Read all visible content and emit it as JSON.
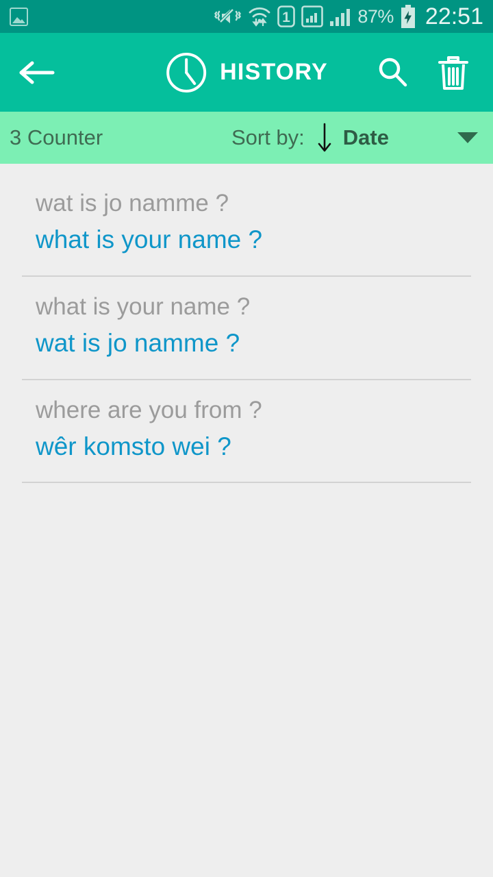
{
  "status_bar": {
    "notification_icon": "photo-icon",
    "vibrate_icon": "vibrate-mute-icon",
    "wifi_icon": "wifi-transfer-icon",
    "sim_label": "1",
    "signal_icon_1": "signal-bars-boxed-icon",
    "signal_icon_2": "signal-bars-icon",
    "battery_percent": "87%",
    "battery_icon": "battery-charging-icon",
    "time": "22:51"
  },
  "app_bar": {
    "back_icon": "arrow-left-icon",
    "clock_icon": "clock-icon",
    "title": "HISTORY",
    "search_icon": "search-icon",
    "delete_icon": "trash-icon"
  },
  "sort_bar": {
    "counter": "3 Counter",
    "sort_label": "Sort by:",
    "direction_icon": "arrow-down-icon",
    "sort_value": "Date",
    "dropdown_icon": "chevron-down-icon"
  },
  "history": [
    {
      "source": "wat is jo namme ?",
      "target": "what is your name ?"
    },
    {
      "source": "what is your name ?",
      "target": "wat is jo namme ?"
    },
    {
      "source": "where are you from ?",
      "target": "wêr komsto wei ?"
    }
  ],
  "colors": {
    "status_bar_bg": "#009482",
    "app_bar_bg": "#05bf9c",
    "sort_bar_bg": "#7cefb4",
    "page_bg": "#eeeeee",
    "source_text": "#9b9b9b",
    "target_text": "#0f96c9"
  }
}
